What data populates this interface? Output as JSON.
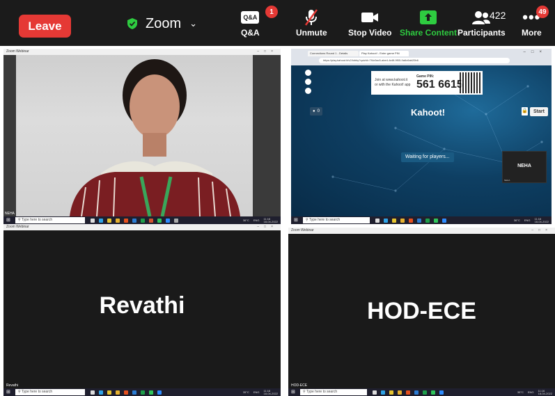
{
  "toolbar": {
    "leave_label": "Leave",
    "brand": "Zoom",
    "qa_icon_text": "Q&A",
    "qa_label": "Q&A",
    "qa_badge": "1",
    "unmute_label": "Unmute",
    "stop_video_label": "Stop Video",
    "share_label": "Share Content",
    "participants_label": "Participants",
    "participants_count": "422",
    "more_label": "More",
    "more_badge": "49",
    "colors": {
      "leave": "#e53935",
      "share": "#2ecc40",
      "bar": "#1b1b1b"
    }
  },
  "panels": {
    "top_left": {
      "window_title": "Zoom Webinar",
      "participant_name": "NEHA",
      "search_placeholder": "Type here to search",
      "tray_temp": "36°C",
      "tray_lang": "ENG",
      "tray_time": "11:16",
      "tray_date": "18-04-2022"
    },
    "top_right": {
      "tab1": "Connections Round 1 - Details",
      "tab2": "Play Kahoot! - Enter game PIN",
      "url": "https://play.kahoot.it/v2/lobby?quizId=7f4c0ac5-abe4-4e8f-9f05-9a6c6ab20b6",
      "join_line1": "Join at www.kahoot.it",
      "join_line2": "or with the Kahoot! app",
      "pin_label": "Game PIN:",
      "pin": "561 6615",
      "logo": "Kahoot!",
      "player_count": "0",
      "start_label": "Start",
      "waiting": "Waiting for players...",
      "tile_name": "NEHA",
      "tile_small": "NEHA",
      "search_placeholder": "Type here to search",
      "tray_temp": "36°C",
      "tray_lang": "ENG",
      "tray_time": "11:16",
      "tray_date": "18-04-2022"
    },
    "bottom_left": {
      "window_title": "Zoom Webinar",
      "big_name": "Revathi",
      "small_name": "Revathi",
      "search_placeholder": "Type here to search",
      "tray_temp": "35°C",
      "tray_lang": "ENG",
      "tray_time": "11:16",
      "tray_date": "18-04-2022"
    },
    "bottom_right": {
      "window_title": "Zoom Webinar",
      "big_name": "HOD-ECE",
      "small_name": "HOD-ECE",
      "search_placeholder": "Type here to search",
      "tray_temp": "35°C",
      "tray_lang": "ENG",
      "tray_time": "11:16",
      "tray_date": "18-04-2022"
    }
  }
}
